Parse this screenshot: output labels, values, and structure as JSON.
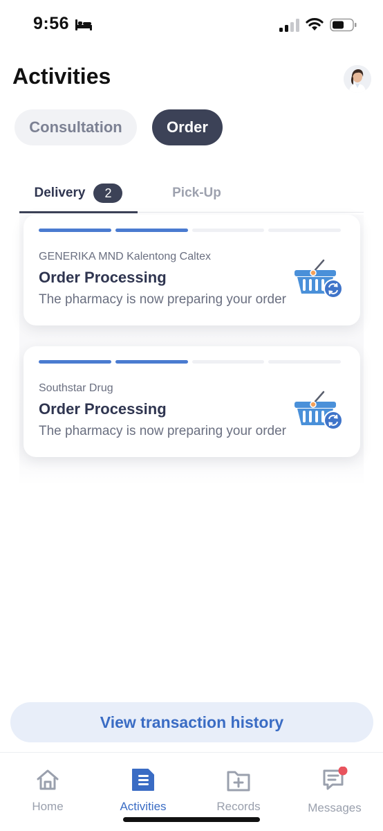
{
  "status_bar": {
    "time": "9:56"
  },
  "header": {
    "title": "Activities"
  },
  "segments": [
    {
      "label": "Consultation",
      "active": false
    },
    {
      "label": "Order",
      "active": true
    }
  ],
  "tabs": [
    {
      "label": "Delivery",
      "badge": "2",
      "active": true
    },
    {
      "label": "Pick-Up",
      "active": false
    }
  ],
  "orders": [
    {
      "pharmacy": "GENERIKA MND Kalentong Caltex",
      "status": "Order Processing",
      "description": "The pharmacy is now preparing your order",
      "progress_steps_completed": 2,
      "progress_steps_total": 4,
      "icon": "basket-icon"
    },
    {
      "pharmacy": "Southstar Drug",
      "status": "Order Processing",
      "description": "The pharmacy is now preparing your order",
      "progress_steps_completed": 2,
      "progress_steps_total": 4,
      "icon": "basket-icon"
    }
  ],
  "history_button": {
    "label": "View transaction history"
  },
  "bottom_nav": [
    {
      "label": "Home",
      "icon": "home-icon",
      "active": false
    },
    {
      "label": "Activities",
      "icon": "activities-icon",
      "active": true
    },
    {
      "label": "Records",
      "icon": "records-icon",
      "active": false
    },
    {
      "label": "Messages",
      "icon": "messages-icon",
      "active": false,
      "notification": true
    }
  ],
  "colors": {
    "accent": "#3a6cc4",
    "progress_active": "#4a7bd0",
    "dark_pill": "#3c4257",
    "notification_dot": "#e8535d"
  }
}
